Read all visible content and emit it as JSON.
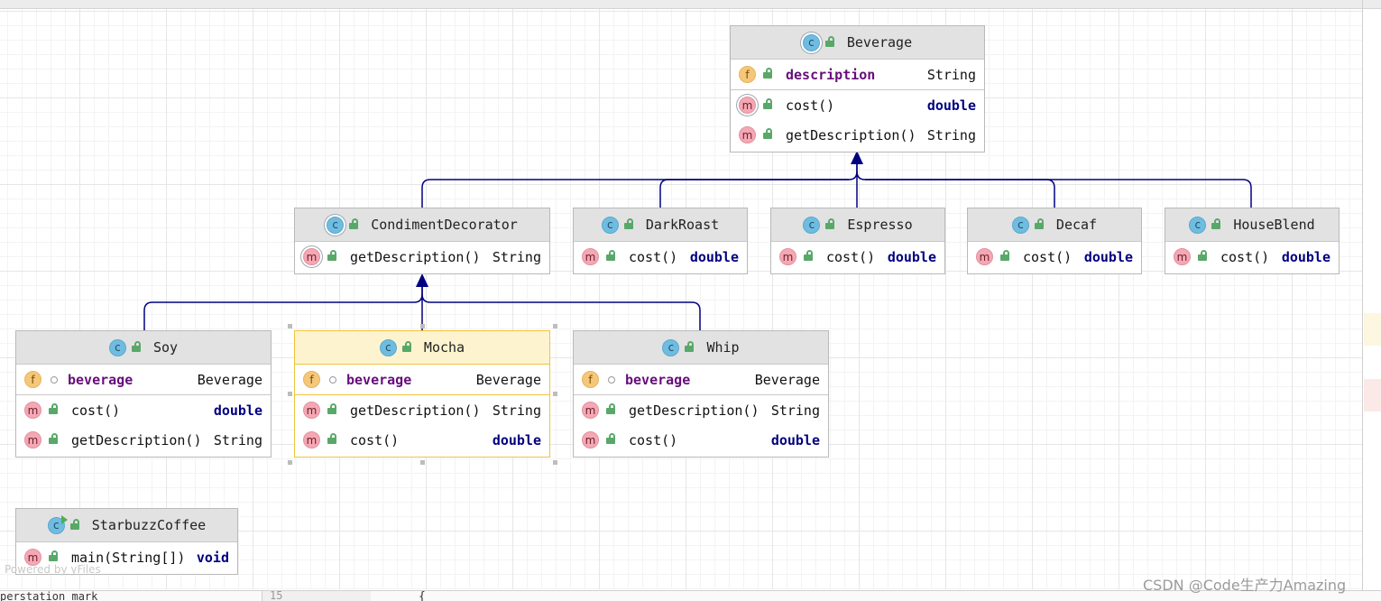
{
  "diagram": {
    "classes": {
      "beverage": {
        "name": "Beverage",
        "fields": [
          {
            "name": "description",
            "type": "String"
          }
        ],
        "methods": [
          {
            "name": "cost()",
            "type": "double"
          },
          {
            "name": "getDescription()",
            "type": "String"
          }
        ]
      },
      "condiment_decorator": {
        "name": "CondimentDecorator",
        "methods": [
          {
            "name": "getDescription()",
            "type": "String"
          }
        ]
      },
      "dark_roast": {
        "name": "DarkRoast",
        "methods": [
          {
            "name": "cost()",
            "type": "double"
          }
        ]
      },
      "espresso": {
        "name": "Espresso",
        "methods": [
          {
            "name": "cost()",
            "type": "double"
          }
        ]
      },
      "decaf": {
        "name": "Decaf",
        "methods": [
          {
            "name": "cost()",
            "type": "double"
          }
        ]
      },
      "house_blend": {
        "name": "HouseBlend",
        "methods": [
          {
            "name": "cost()",
            "type": "double"
          }
        ]
      },
      "soy": {
        "name": "Soy",
        "fields": [
          {
            "name": "beverage",
            "type": "Beverage"
          }
        ],
        "methods": [
          {
            "name": "cost()",
            "type": "double"
          },
          {
            "name": "getDescription()",
            "type": "String"
          }
        ]
      },
      "mocha": {
        "name": "Mocha",
        "fields": [
          {
            "name": "beverage",
            "type": "Beverage"
          }
        ],
        "methods": [
          {
            "name": "getDescription()",
            "type": "String"
          },
          {
            "name": "cost()",
            "type": "double"
          }
        ]
      },
      "whip": {
        "name": "Whip",
        "fields": [
          {
            "name": "beverage",
            "type": "Beverage"
          }
        ],
        "methods": [
          {
            "name": "getDescription()",
            "type": "String"
          },
          {
            "name": "cost()",
            "type": "double"
          }
        ]
      },
      "starbuzz_coffee": {
        "name": "StarbuzzCoffee",
        "methods": [
          {
            "name": "main(String[])",
            "type": "void"
          }
        ]
      }
    },
    "icon_letters": {
      "class": "c",
      "field": "f",
      "method": "m"
    },
    "edge_color": "#000080",
    "selection_color": "#f0c33c"
  },
  "footer": {
    "powered_by": "Powered by yFiles",
    "left_text": "perstation mark",
    "line_number": "15",
    "brace": "{",
    "watermark": "CSDN @Code生产力Amazing"
  }
}
